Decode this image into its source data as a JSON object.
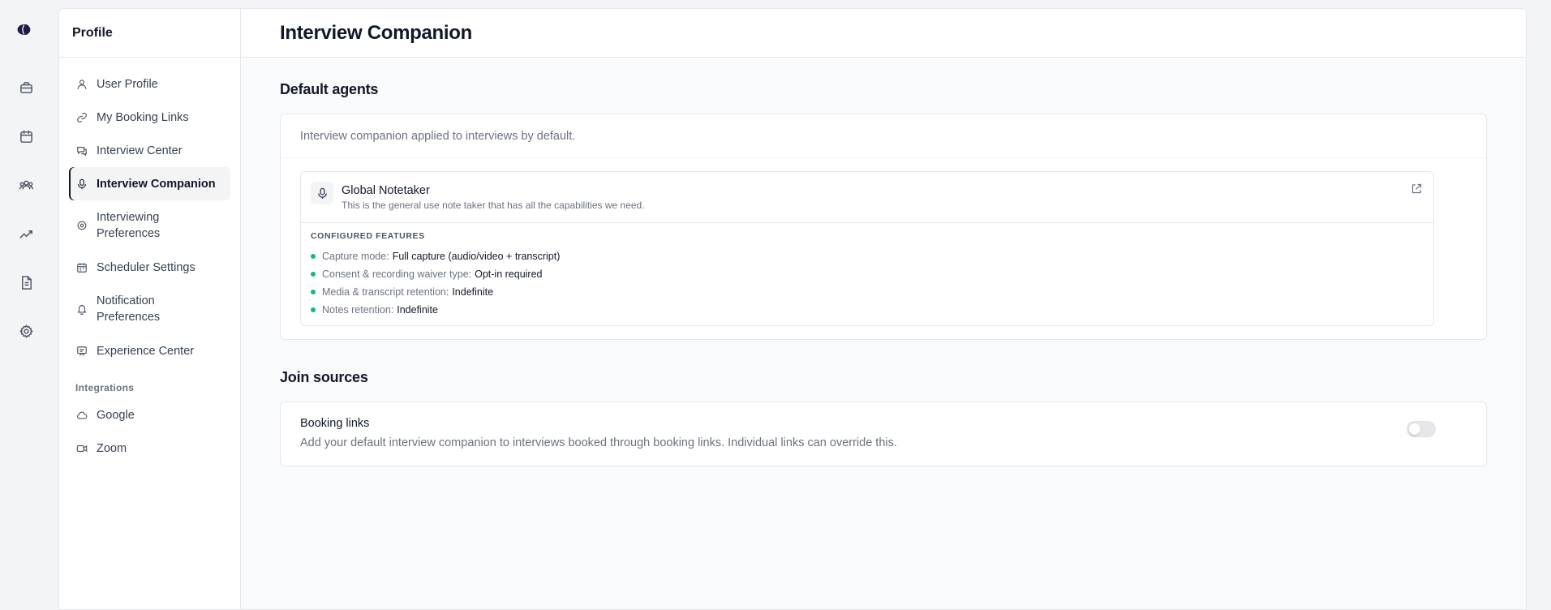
{
  "rail": {
    "icons": [
      "logo-icon",
      "briefcase-icon",
      "calendar-icon",
      "users-icon",
      "trending-icon",
      "document-icon",
      "settings-icon"
    ]
  },
  "sidebar": {
    "title": "Profile",
    "items": [
      {
        "label": "User Profile",
        "icon": "user-icon"
      },
      {
        "label": "My Booking Links",
        "icon": "link-icon"
      },
      {
        "label": "Interview Center",
        "icon": "chat-icon"
      },
      {
        "label": "Interview Companion",
        "icon": "microphone-icon"
      },
      {
        "label": "Interviewing Preferences",
        "icon": "settings-icon"
      },
      {
        "label": "Scheduler Settings",
        "icon": "calendar-icon"
      },
      {
        "label": "Notification Preferences",
        "icon": "bell-icon"
      },
      {
        "label": "Experience Center",
        "icon": "presentation-icon"
      }
    ],
    "integrations_title": "Integrations",
    "integrations": [
      {
        "label": "Google",
        "icon": "cloud-icon"
      },
      {
        "label": "Zoom",
        "icon": "video-icon"
      }
    ]
  },
  "page": {
    "title": "Interview Companion"
  },
  "default_agents": {
    "title": "Default agents",
    "description": "Interview companion applied to interviews by default.",
    "agent": {
      "name": "Global Notetaker",
      "description": "This is the general use note taker that has all the capabilities we need.",
      "features_title": "CONFIGURED FEATURES",
      "features": [
        {
          "label": "Capture mode:",
          "value": "Full capture (audio/video + transcript)"
        },
        {
          "label": "Consent & recording waiver type:",
          "value": "Opt-in required"
        },
        {
          "label": "Media & transcript retention:",
          "value": "Indefinite"
        },
        {
          "label": "Notes retention:",
          "value": "Indefinite"
        }
      ]
    }
  },
  "join_sources": {
    "title": "Join sources",
    "booking_links": {
      "title": "Booking links",
      "description": "Add your default interview companion to interviews booked through booking links. Individual links can override this.",
      "enabled": false
    }
  },
  "colors": {
    "feature_dot": "#10b981",
    "active_indicator": "#111827"
  }
}
